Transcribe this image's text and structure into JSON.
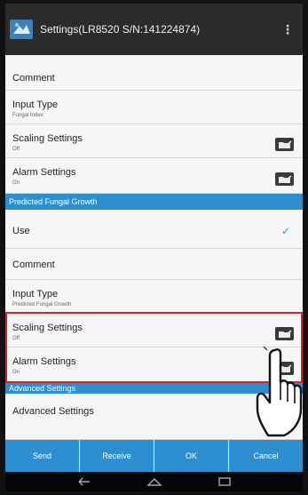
{
  "title": "Settings(LR8520 S/N:141224874)",
  "icons": {
    "app": "app-icon",
    "overflow": "overflow-menu-icon",
    "folder": "folder-settings-icon",
    "check": "check-icon",
    "back": "back-nav-icon",
    "home": "home-nav-icon",
    "recent": "recent-apps-icon",
    "hand": "pointing-hand-icon"
  },
  "rows": {
    "comment1": {
      "label": "Comment"
    },
    "input1": {
      "label": "Input Type",
      "sub": "Fungal Index"
    },
    "scaling1": {
      "label": "Scaling Settings",
      "sub": "Off"
    },
    "alarm1": {
      "label": "Alarm Settings",
      "sub": "On"
    },
    "section_predicted": "Predicted Fungal Growth",
    "use": {
      "label": "Use"
    },
    "comment2": {
      "label": "Comment"
    },
    "input2": {
      "label": "Input Type",
      "sub": "Predicted Fungal Growth"
    },
    "scaling2": {
      "label": "Scaling Settings",
      "sub": "Off"
    },
    "alarm2": {
      "label": "Alarm Settings",
      "sub": "On"
    },
    "section_advanced": "Advanced Settings",
    "advanced": {
      "label": "Advanced Settings"
    }
  },
  "buttons": {
    "send": "Send",
    "receive": "Receive",
    "ok": "OK",
    "cancel": "Cancel"
  },
  "colors": {
    "accent": "#2e8fd0",
    "highlight": "#d3242d",
    "titlebar": "#2b2b2b"
  }
}
